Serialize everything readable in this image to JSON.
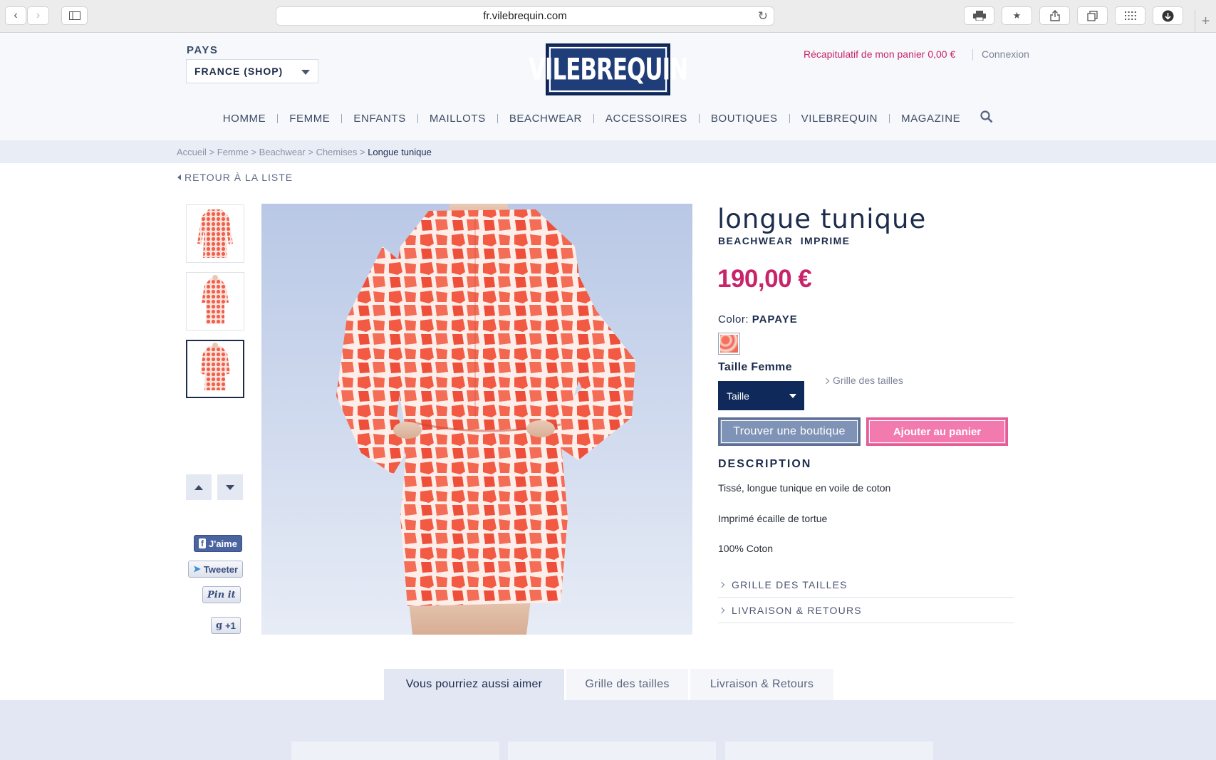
{
  "browser": {
    "url": "fr.vilebrequin.com",
    "icons": [
      "back-arrow-icon",
      "forward-arrow-icon",
      "sidebar-icon",
      "reload-icon",
      "print-icon",
      "bookmark-icon",
      "share-icon",
      "tabs-icon",
      "grid-icon",
      "download-icon",
      "new-tab-icon"
    ]
  },
  "header": {
    "pays_label": "PAYS",
    "country": "FRANCE (SHOP)",
    "logo_text": "VILEBREQUIN",
    "cart_summary": "Récapitulatif de mon panier 0,00 €",
    "login": "Connexion"
  },
  "nav": [
    "HOMME",
    "FEMME",
    "ENFANTS",
    "MAILLOTS",
    "BEACHWEAR",
    "ACCESSOIRES",
    "BOUTIQUES",
    "VILEBREQUIN",
    "MAGAZINE"
  ],
  "breadcrumb": {
    "items": [
      "Accueil",
      "Femme",
      "Beachwear",
      "Chemises"
    ],
    "current": "Longue tunique",
    "separator": ">"
  },
  "back_link": "RETOUR À LA LISTE",
  "social": {
    "facebook": "J'aime",
    "twitter": "Tweeter",
    "pinterest": "Pin it",
    "google": "+1"
  },
  "product": {
    "title": "longue tunique",
    "subtitle": "BEACHWEAR  IMPRIME",
    "price": "190,00 €",
    "color_label": "Color:",
    "color_value": "PAPAYE",
    "size_label": "Taille Femme",
    "size_guide": "Grille des tailles",
    "size_select": "Taille",
    "find_store": "Trouver une boutique",
    "add_to_cart": "Ajouter au panier",
    "description_title": "DESCRIPTION",
    "description": [
      "Tissé, longue tunique en voile de coton",
      "Imprimé écaille de tortue",
      "100% Coton"
    ],
    "accordion": [
      "GRILLE DES TAILLES",
      "LIVRAISON & RETOURS"
    ]
  },
  "tabs": [
    "Vous pourriez aussi aimer",
    "Grille des tailles",
    "Livraison & Retours"
  ],
  "colors": {
    "navy": "#1c2c4c",
    "pink": "#c8246a",
    "button_pink": "#f27aaf",
    "button_blue": "#7f93b7"
  }
}
